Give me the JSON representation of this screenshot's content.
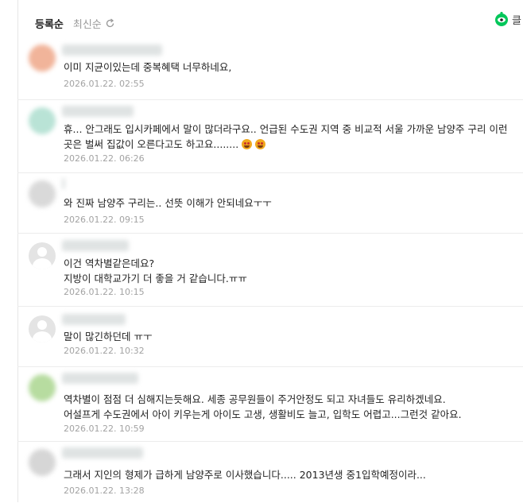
{
  "sort": {
    "active": "등록순",
    "latest": "최신순"
  },
  "right_widget": {
    "label": "클"
  },
  "colors": {
    "accent": "#03c75a"
  },
  "comments": [
    {
      "avatar": "blurred",
      "avatar_color": "#f1b49a",
      "text": "이미 지균이있는데 중복혜택 너무하네요,",
      "date": "2026.01.22. 02:55",
      "emoji_count": 0
    },
    {
      "avatar": "blurred",
      "avatar_color": "#b9e3d6",
      "text": "휴... 안그래도 입시카페에서 말이 많더라구요.. 언급된 수도권 지역 중 비교적 서울 가까운 남양주 구리 이런 곳은 벌써 집값이 오른다고도 하고요........",
      "date": "2026.01.22. 06:26",
      "emoji_count": 2
    },
    {
      "avatar": "blurred",
      "avatar_color": "#d9d9d9",
      "text": "와 진짜 남양주 구리는.. 선뜻 이해가 안되네요ㅜㅜ",
      "date": "2026.01.22. 09:15",
      "emoji_count": 0
    },
    {
      "avatar": "default",
      "avatar_color": "#e4e4e4",
      "text": "이건 역차별같은데요?\n지방이 대학교가기 더 좋을 거 같습니다.ㅠㅠ",
      "date": "2026.01.22. 10:15",
      "emoji_count": 0
    },
    {
      "avatar": "default",
      "avatar_color": "#e4e4e4",
      "text": "말이 많긴하던데 ㅠㅜ",
      "date": "2026.01.22. 10:32",
      "emoji_count": 0
    },
    {
      "avatar": "blurred",
      "avatar_color": "#b7dca0",
      "text": "역차별이 점점 더 심해지는듯해요. 세종 공무원들이 주거안정도 되고 자녀들도 유리하겠네요.\n어설프게 수도권에서 아이 키우는게 아이도 고생, 생활비도 늘고, 입학도 어렵고...그런것 같아요.",
      "date": "2026.01.22. 10:59",
      "emoji_count": 0
    },
    {
      "avatar": "blurred",
      "avatar_color": "#d6d6d6",
      "text": "그래서 지인의 형제가 급하게 남양주로 이사했습니다..... 2013년생 중1입학예정이라...",
      "date": "2026.01.22. 13:28",
      "emoji_count": 0
    }
  ]
}
